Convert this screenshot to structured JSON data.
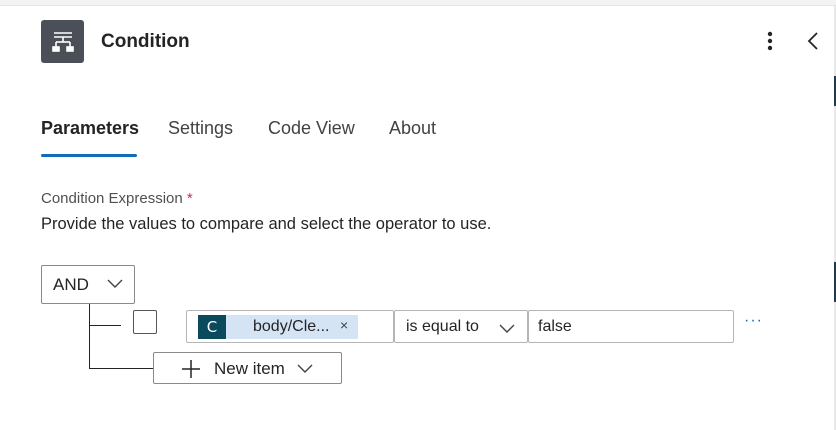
{
  "header": {
    "icon": "condition-icon",
    "title": "Condition",
    "more_icon": "more-vertical-icon",
    "collapse_icon": "chevron-left-icon"
  },
  "tabs": [
    {
      "label": "Parameters",
      "active": true
    },
    {
      "label": "Settings",
      "active": false
    },
    {
      "label": "Code View",
      "active": false
    },
    {
      "label": "About",
      "active": false
    }
  ],
  "condition": {
    "label": "Condition Expression",
    "required_mark": "*",
    "description": "Provide the values to compare and select the operator to use.",
    "group_operator": "AND",
    "rows": [
      {
        "checked": false,
        "token": {
          "icon_letter": "C",
          "text": "body/Cle...",
          "remove": "×"
        },
        "operator": "is equal to",
        "value": "false",
        "more": "···"
      }
    ],
    "new_item_label": "New item"
  },
  "colors": {
    "accent": "#0f6cbd",
    "icon_bg": "#4a4f58",
    "token_bg": "#d4e4f4",
    "token_icon_bg": "#0b4a5c",
    "required": "#c4314b"
  }
}
